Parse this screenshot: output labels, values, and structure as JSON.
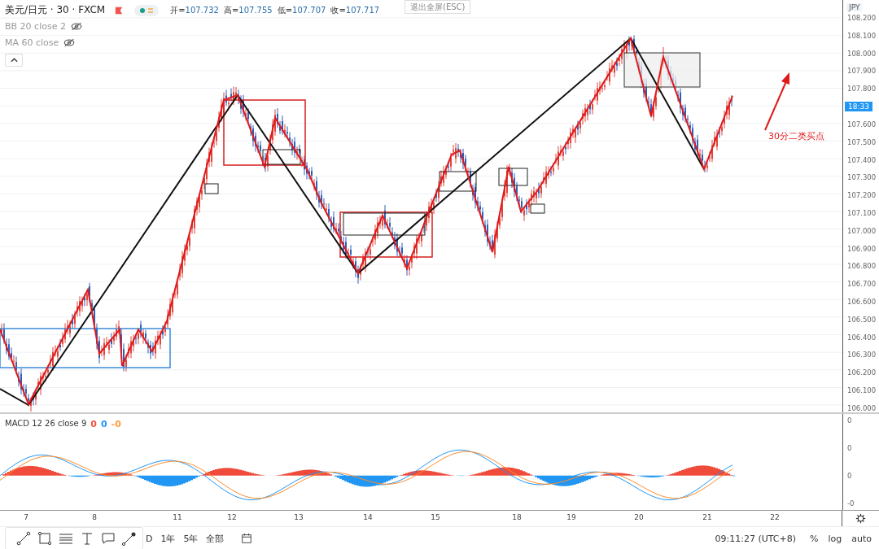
{
  "header": {
    "symbol": "美元/日元 · 30 · FXCM",
    "ohlc": [
      {
        "label": "开=",
        "value": "107.732"
      },
      {
        "label": "高=",
        "value": "107.755"
      },
      {
        "label": "低=",
        "value": "107.707"
      },
      {
        "label": "收=",
        "value": "107.717"
      }
    ],
    "indicators": [
      {
        "name": "BB 20 close 2"
      },
      {
        "name": "MA 60 close"
      }
    ]
  },
  "fullscreen_hint": "退出全屏(ESC)",
  "price_axis": {
    "currency": "JPY",
    "current": "18:33",
    "ticks_above": [
      "108.200",
      "108.100",
      "108.000",
      "107.900",
      "107.800"
    ],
    "ticks_below": [
      "107.600",
      "107.500",
      "107.400",
      "107.300",
      "107.200",
      "107.100",
      "107.000",
      "106.900",
      "106.800",
      "106.700",
      "106.600",
      "106.500",
      "106.400",
      "106.300",
      "106.200",
      "106.100",
      "106.000"
    ]
  },
  "annotation": "30分二类买点",
  "macd": {
    "label": "MACD 12 26 close 9",
    "values": [
      {
        "text": "0",
        "color": "#f0513e"
      },
      {
        "text": "0",
        "color": "#2196f3"
      },
      {
        "text": "-0",
        "color": "#ff9c40"
      }
    ],
    "ticks": [
      "0",
      "0",
      "0",
      "-0"
    ]
  },
  "time_axis": [
    "7",
    "8",
    "11",
    "12",
    "13",
    "14",
    "15",
    "18",
    "19",
    "20",
    "21",
    "22"
  ],
  "bottom_bar": {
    "ranges": [
      "D",
      "1年",
      "5年",
      "全部"
    ],
    "clock": "09:11:27 (UTC+8)",
    "options": [
      "%",
      "log",
      "auto"
    ]
  }
}
